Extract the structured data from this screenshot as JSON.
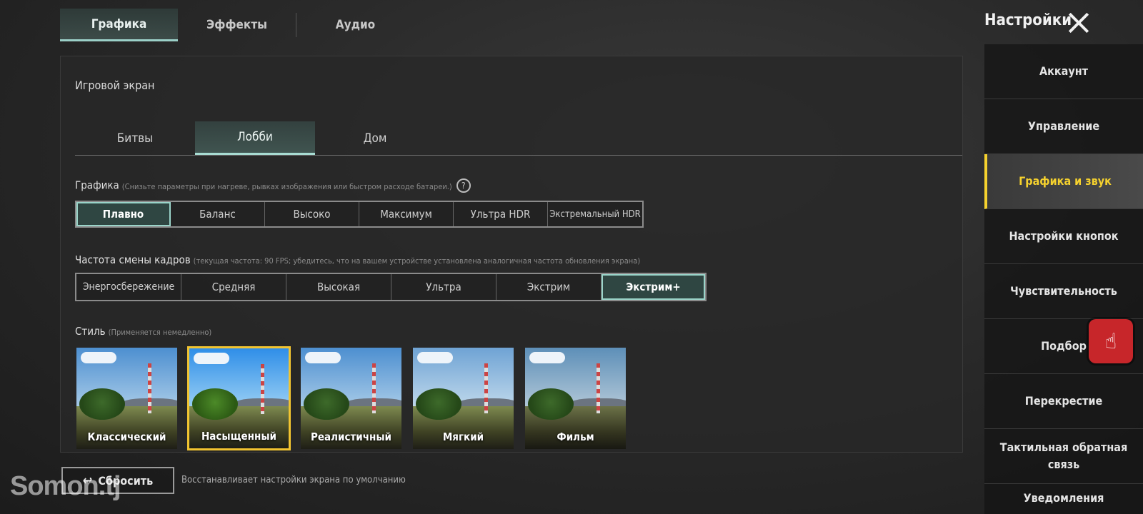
{
  "top_tabs": [
    {
      "label": "Графика",
      "active": true
    },
    {
      "label": "Эффекты",
      "active": false
    },
    {
      "label": "Аудио",
      "active": false
    }
  ],
  "header": {
    "title": "Настройки"
  },
  "section": {
    "title": "Игровой экран"
  },
  "sub_tabs": [
    {
      "label": "Битвы",
      "active": false
    },
    {
      "label": "Лобби",
      "active": true
    },
    {
      "label": "Дом",
      "active": false
    }
  ],
  "graphics": {
    "label": "Графика",
    "hint": "(Снизьте параметры при нагреве, рывках изображения или быстром расходе батареи.)",
    "help_icon": "help-circle-icon",
    "options": [
      "Плавно",
      "Баланс",
      "Высоко",
      "Максимум",
      "Ультра HDR",
      "Экстремальный HDR"
    ],
    "selected": "Плавно"
  },
  "fps": {
    "label": "Частота смены кадров",
    "hint": "(текущая частота: 90 FPS; убедитесь, что на вашем устройстве установлена аналогичная частота обновления экрана)",
    "options": [
      "Энергосбережение",
      "Средняя",
      "Высокая",
      "Ультра",
      "Экстрим",
      "Экстрим+"
    ],
    "selected": "Экстрим+"
  },
  "style": {
    "label": "Стиль",
    "hint": "(Применяется немедленно)",
    "options": [
      "Классический",
      "Насыщенный",
      "Реалистичный",
      "Мягкий",
      "Фильм"
    ],
    "selected": "Насыщенный"
  },
  "reset": {
    "label": "Сбросить",
    "icon": "undo-icon",
    "hint": "Восстанавливает настройки экрана по умолчанию"
  },
  "sidebar": {
    "items": [
      {
        "label": "Аккаунт",
        "active": false
      },
      {
        "label": "Управление",
        "active": false
      },
      {
        "label": "Графика и звук",
        "active": true
      },
      {
        "label": "Настройки кнопок",
        "active": false
      },
      {
        "label": "Чувствительность",
        "active": false
      },
      {
        "label": "Подбор",
        "active": false
      },
      {
        "label": "Перекрестие",
        "active": false
      },
      {
        "label": "Тактильная обратная связь",
        "active": false
      },
      {
        "label": "Уведомления",
        "active": false
      }
    ]
  },
  "watermark": "Somon.tj",
  "colors": {
    "accent_teal": "#9ad4c9",
    "accent_yellow": "#f6d22e",
    "assist_red": "#c7262a"
  }
}
